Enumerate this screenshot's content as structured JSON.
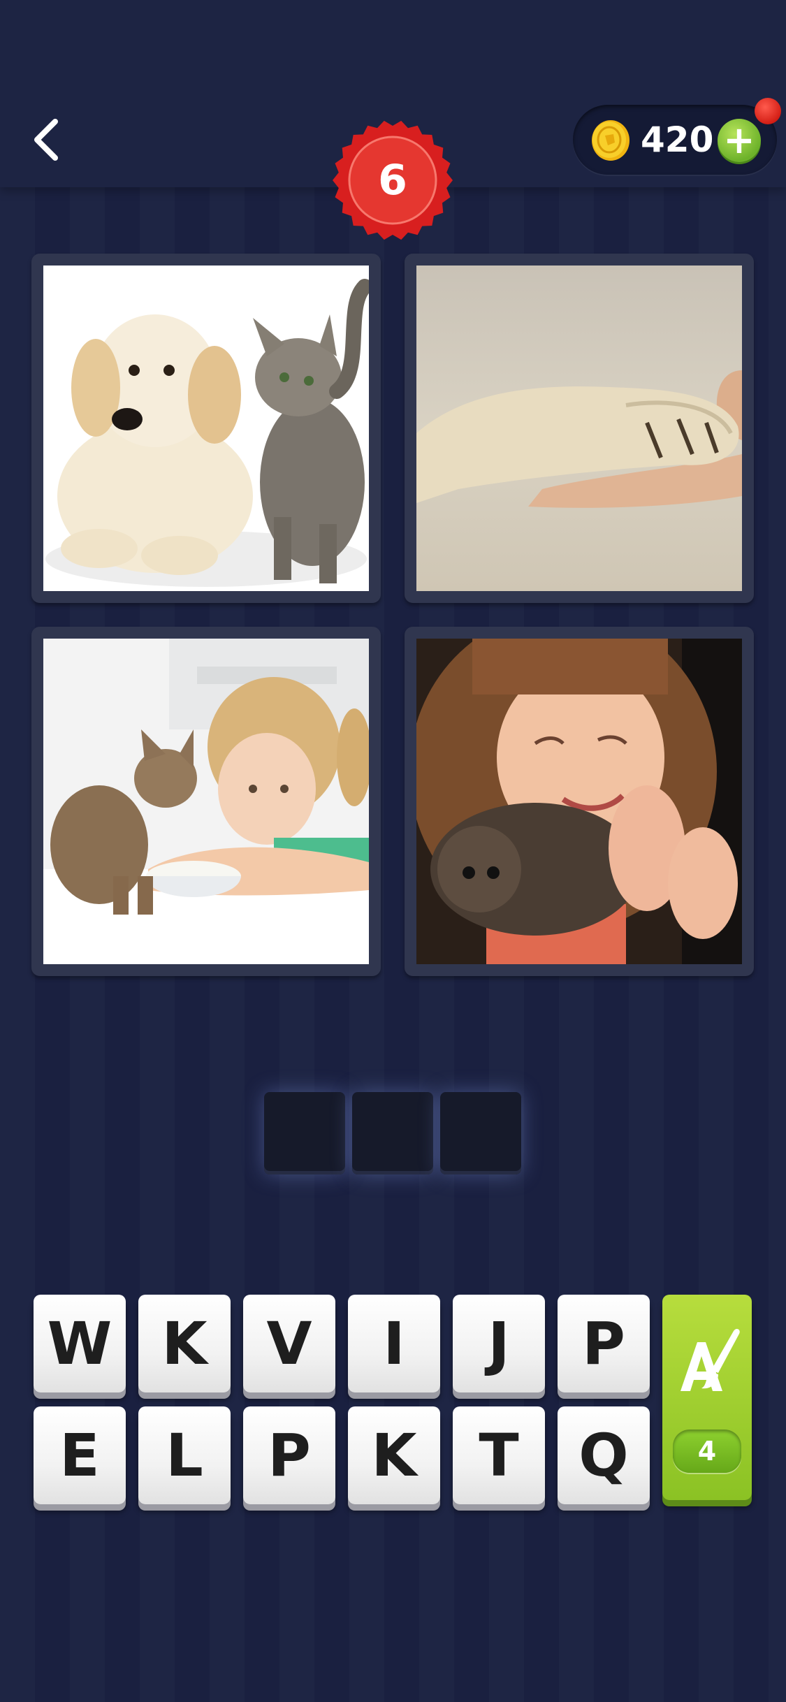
{
  "header": {
    "level": "6",
    "coins": "420",
    "plus_label": "+"
  },
  "pictures": [
    {
      "subject": "puppy-and-kitten"
    },
    {
      "subject": "dog-paw-in-hand"
    },
    {
      "subject": "girl-with-kitten-and-milk"
    },
    {
      "subject": "girl-hugging-kitten"
    }
  ],
  "answer": {
    "length": 3,
    "slots": [
      "",
      "",
      ""
    ]
  },
  "keyboard": {
    "row1": [
      "W",
      "K",
      "V",
      "I",
      "J",
      "P"
    ],
    "row2": [
      "E",
      "L",
      "P",
      "K",
      "T",
      "Q"
    ]
  },
  "hint": {
    "icon": "letter-brush-icon",
    "cost": "4"
  },
  "colors": {
    "background": "#1b2140",
    "level_badge": "#e22a26",
    "hint_green": "#9fcf30",
    "plus_green": "#7cc132",
    "coin_gold": "#f5c21b",
    "notify_red": "#e02a1f"
  }
}
